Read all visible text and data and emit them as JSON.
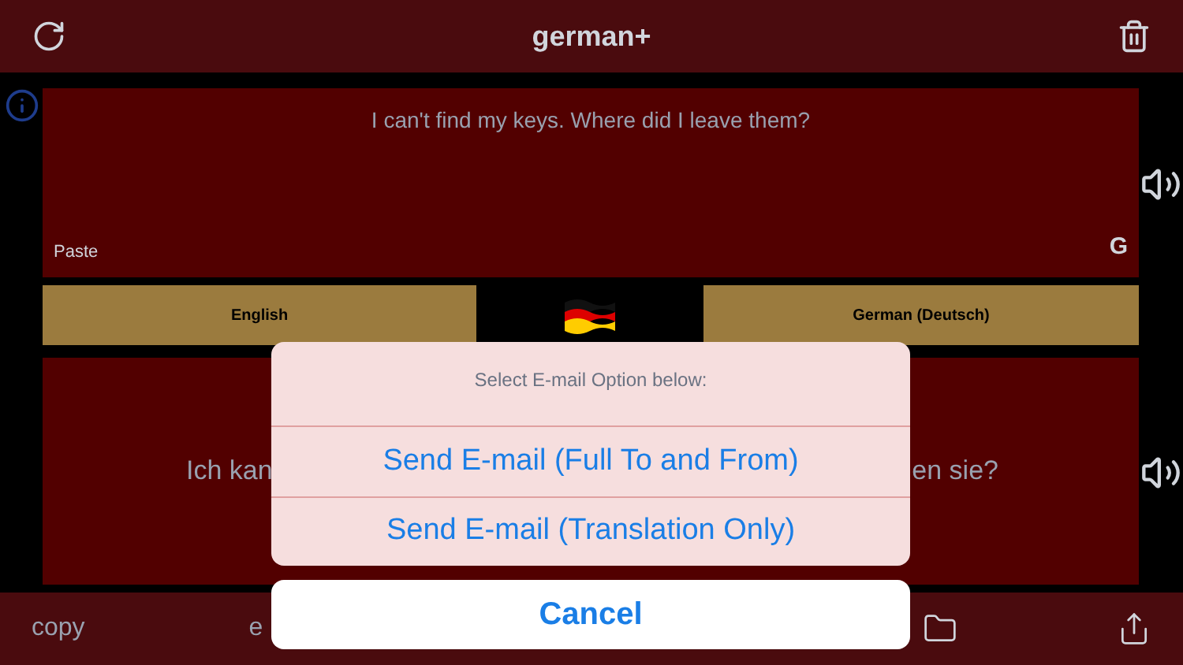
{
  "header": {
    "title": "german+"
  },
  "source": {
    "text": "I can't find my keys. Where did I leave them?",
    "paste": "Paste",
    "g_label": "G"
  },
  "languages": [
    {
      "label": "English"
    },
    {
      "label": "German (Deutsch)"
    }
  ],
  "target": {
    "text_start": "Ich kan",
    "text_end": "en sie?"
  },
  "toolbar": {
    "copy": "copy",
    "item_2": "e"
  },
  "action_sheet": {
    "title": "Select E-mail Option below:",
    "options": [
      {
        "label": "Send E-mail (Full To and From)"
      },
      {
        "label": "Send E-mail (Translation Only)"
      }
    ],
    "cancel": "Cancel"
  }
}
